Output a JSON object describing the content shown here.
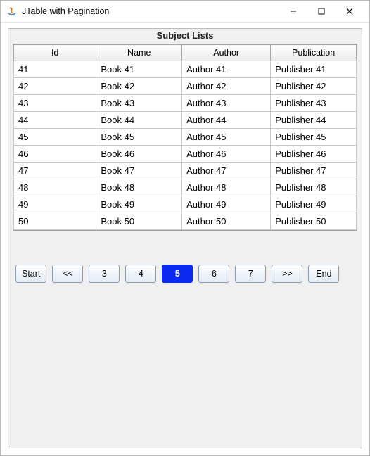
{
  "window": {
    "title": "JTable with Pagination"
  },
  "panel": {
    "title": "Subject Lists"
  },
  "table": {
    "columns": [
      "Id",
      "Name",
      "Author",
      "Publication"
    ],
    "rows": [
      {
        "id": "41",
        "name": "Book 41",
        "author": "Author 41",
        "publication": "Publisher 41"
      },
      {
        "id": "42",
        "name": "Book 42",
        "author": "Author 42",
        "publication": "Publisher 42"
      },
      {
        "id": "43",
        "name": "Book 43",
        "author": "Author 43",
        "publication": "Publisher 43"
      },
      {
        "id": "44",
        "name": "Book 44",
        "author": "Author 44",
        "publication": "Publisher 44"
      },
      {
        "id": "45",
        "name": "Book 45",
        "author": "Author 45",
        "publication": "Publisher 45"
      },
      {
        "id": "46",
        "name": "Book 46",
        "author": "Author 46",
        "publication": "Publisher 46"
      },
      {
        "id": "47",
        "name": "Book 47",
        "author": "Author 47",
        "publication": "Publisher 47"
      },
      {
        "id": "48",
        "name": "Book 48",
        "author": "Author 48",
        "publication": "Publisher 48"
      },
      {
        "id": "49",
        "name": "Book 49",
        "author": "Author 49",
        "publication": "Publisher 49"
      },
      {
        "id": "50",
        "name": "Book 50",
        "author": "Author 50",
        "publication": "Publisher 50"
      }
    ]
  },
  "pagination": {
    "start": "Start",
    "prev": "<<",
    "pages": [
      "3",
      "4",
      "5",
      "6",
      "7"
    ],
    "active_index": 2,
    "next": ">>",
    "end": "End"
  }
}
